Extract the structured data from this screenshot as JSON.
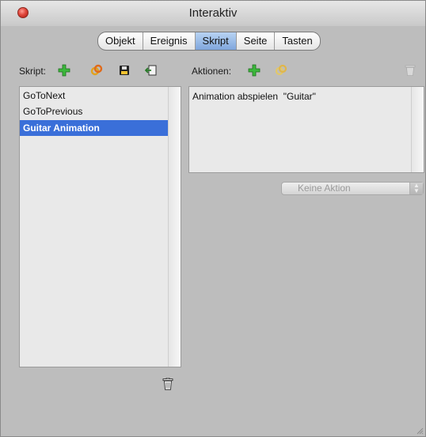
{
  "window": {
    "title": "Interaktiv"
  },
  "tabs": [
    {
      "label": "Objekt",
      "selected": false
    },
    {
      "label": "Ereignis",
      "selected": false
    },
    {
      "label": "Skript",
      "selected": true
    },
    {
      "label": "Seite",
      "selected": false
    },
    {
      "label": "Tasten",
      "selected": false
    }
  ],
  "script_panel": {
    "label": "Skript:",
    "toolbar_icons": [
      "add-icon",
      "link-icon",
      "save-icon",
      "import-icon"
    ],
    "items": [
      "GoToNext",
      "GoToPrevious",
      "Guitar Animation"
    ],
    "selected_index": 2
  },
  "actions_panel": {
    "label": "Aktionen:",
    "toolbar_icons": [
      "add-icon",
      "link-icon"
    ],
    "items": [
      "Animation abspielen  \"Guitar\""
    ],
    "dropdown": {
      "selected": "Keine Aktion",
      "enabled": false
    }
  },
  "colors": {
    "window_bg": "#bdbdbd",
    "selection": "#3a6fd9",
    "tab_selected": "#9fc0ea",
    "add_icon": "#3cb83c"
  }
}
